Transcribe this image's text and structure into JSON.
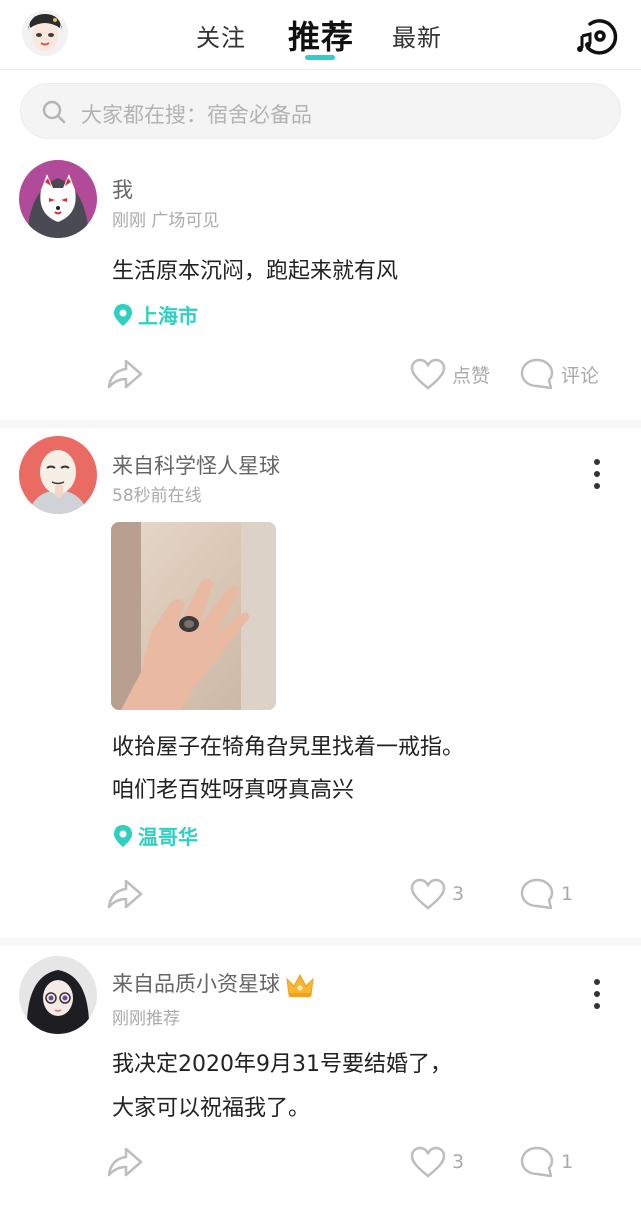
{
  "header": {
    "tabs": [
      {
        "label": "关注"
      },
      {
        "label": "推荐"
      },
      {
        "label": "最新"
      }
    ],
    "accent_color": "#2fd0c2"
  },
  "search": {
    "placeholder": "大家都在搜：宿舍必备品"
  },
  "posts": [
    {
      "user": "我",
      "sub": "刚刚  广场可见",
      "lines": [
        "生活原本沉闷，跑起来就有风"
      ],
      "location": "上海市",
      "like_label": "点赞",
      "comment_label": "评论"
    },
    {
      "user": "来自科学怪人星球",
      "sub": "58秒前在线",
      "lines": [
        "收拾屋子在犄角旮旯里找着一戒指。",
        "咱们老百姓呀真呀真高兴"
      ],
      "location": "温哥华",
      "like_count": "3",
      "comment_count": "1"
    },
    {
      "user": "来自品质小资星球",
      "sub": "刚刚推荐",
      "lines": [
        "我决定2020年9月31号要结婚了，",
        "大家可以祝福我了。"
      ],
      "like_count": "3",
      "comment_count": "1"
    }
  ]
}
